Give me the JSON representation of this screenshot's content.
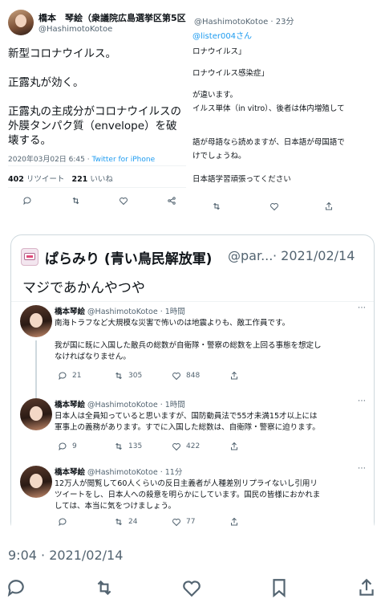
{
  "top_left": {
    "name": "橋本　琴絵（衆議院広島選挙区第5区",
    "handle": "@HashimotoKotoe",
    "tweet_lines": [
      "新型コロナウイルス。",
      "",
      "正露丸が効く。",
      "",
      "正露丸の主成分がコロナウイルスの",
      "外膜タンパク質（envelope）を破",
      "壊する。"
    ],
    "timestamp": "2020年03月02日 6:45 ·",
    "source": "Twitter for iPhone",
    "retweets_count": "402",
    "retweets_label": "リツイート",
    "likes_count": "221",
    "likes_label": "いいね"
  },
  "top_right": {
    "header": "@HashimotoKotoe · 23分",
    "reply_to": "@lister004さん",
    "lines": [
      "ロナウイルス」",
      "ロナウイルス感染症」",
      "が違います。",
      "イルス単体（in vitro）、後者は体内増殖して",
      "語が母語なら読めますが、日本語が母国語で",
      "けでしょうね。",
      "日本語学習頑張ってください"
    ]
  },
  "quote": {
    "name": "ぱらみり (青い鳥民解放軍)",
    "handle": "@par...",
    "date": "· 2021/02/14",
    "text": "マジであかんやつや",
    "replies": [
      {
        "name": "橋本琴絵",
        "handle": "@HashimotoKotoe · 1時間",
        "lines": [
          "南海トラフなど大規模な災害で怖いのは地震よりも、敵工作員です。",
          "",
          "我が国に既に入国した敵兵の総数が自衛隊・警察の総数を上回る事態を想定し",
          "なければなりません。"
        ],
        "reply_count": "21",
        "retweet_count": "305",
        "like_count": "848"
      },
      {
        "name": "橋本琴絵",
        "handle": "@HashimotoKotoe · 1時間",
        "lines": [
          "日本人は全員知っていると思いますが、国防動員法で55才未満15才以上には",
          "軍事上の義務があります。すでに入国した総数は、自衛隊・警察に迫ります。"
        ],
        "reply_count": "9",
        "retweet_count": "135",
        "like_count": "422"
      },
      {
        "name": "橋本琴絵",
        "handle": "@HashimotoKotoe · 11分",
        "lines": [
          "12万人が閲覧して60人くらいの反日主義者が人種差別リプライないし引用リ",
          "ツイートをし、日本人への殺意を明らかにしています。国民の皆様におかれま",
          "しては、本当に気をつけましょう。"
        ],
        "reply_count": "",
        "retweet_count": "24",
        "like_count": "77"
      }
    ]
  },
  "footer": {
    "timestamp": "9:04 · 2021/02/14"
  },
  "colors": {
    "link": "#1d9bf0",
    "gray": "#536471",
    "border": "#cfd9de"
  }
}
